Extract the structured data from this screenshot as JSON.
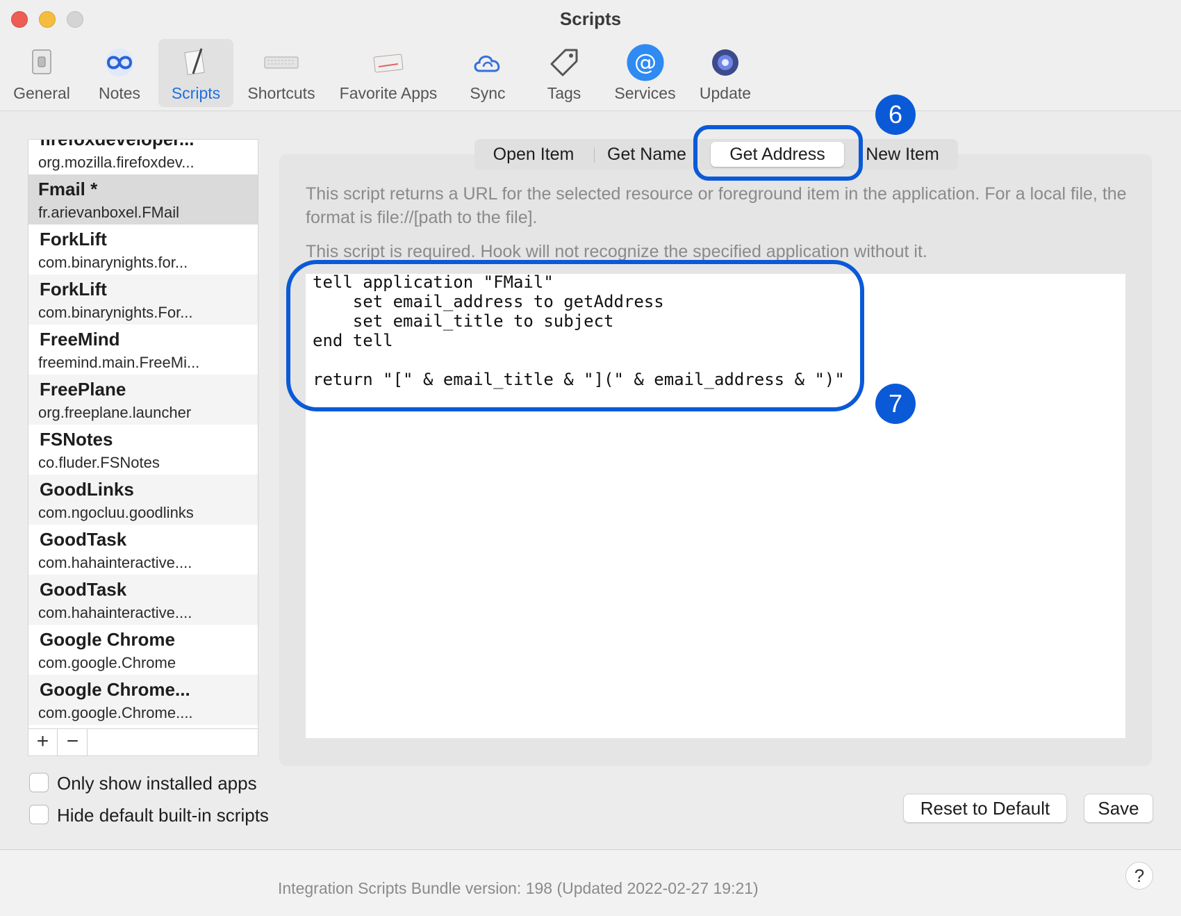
{
  "window": {
    "title": "Scripts"
  },
  "toolbar": {
    "items": [
      {
        "label": "General",
        "icon": "general-switch-icon"
      },
      {
        "label": "Notes",
        "icon": "notes-infinity-icon"
      },
      {
        "label": "Scripts",
        "icon": "scripts-paper-pen-icon",
        "active": true
      },
      {
        "label": "Shortcuts",
        "icon": "keyboard-icon"
      },
      {
        "label": "Favorite Apps",
        "icon": "favorite-apps-icon"
      },
      {
        "label": "Sync",
        "icon": "cloud-sync-icon"
      },
      {
        "label": "Tags",
        "icon": "tag-icon"
      },
      {
        "label": "Services",
        "icon": "at-sign-icon"
      },
      {
        "label": "Update",
        "icon": "update-icon"
      }
    ]
  },
  "sidebar": {
    "partial_top": {
      "name": "firefoxdeveloper...",
      "bundle": "org.mozilla.firefoxdev..."
    },
    "items": [
      {
        "name": "Fmail *",
        "bundle": "fr.arievanboxel.FMail",
        "selected": true
      },
      {
        "name": "ForkLift",
        "bundle": "com.binarynights.for..."
      },
      {
        "name": "ForkLift",
        "bundle": "com.binarynights.For..."
      },
      {
        "name": "FreeMind",
        "bundle": "freemind.main.FreeMi..."
      },
      {
        "name": "FreePlane",
        "bundle": "org.freeplane.launcher"
      },
      {
        "name": "FSNotes",
        "bundle": "co.fluder.FSNotes"
      },
      {
        "name": "GoodLinks",
        "bundle": "com.ngocluu.goodlinks"
      },
      {
        "name": "GoodTask",
        "bundle": "com.hahainteractive...."
      },
      {
        "name": "GoodTask",
        "bundle": "com.hahainteractive...."
      },
      {
        "name": "Google Chrome",
        "bundle": "com.google.Chrome"
      },
      {
        "name": "Google Chrome...",
        "bundle": "com.google.Chrome...."
      }
    ],
    "add_label": "+",
    "remove_label": "−"
  },
  "tabs": {
    "open_item": "Open Item",
    "get_name": "Get Name",
    "get_address": "Get Address",
    "new_item": "New Item",
    "selected": "Get Address"
  },
  "main": {
    "description": "This script returns a URL for the selected resource or foreground item in the application.  For a local file, the format is file://[path to the file].",
    "required": "This script is required. Hook will not recognize the specified application without it.",
    "code": "tell application \"FMail\"\n    set email_address to getAddress\n    set email_title to subject\nend tell\n\nreturn \"[\" & email_title & \"](\" & email_address & \")\""
  },
  "annotations": {
    "badge_6": "6",
    "badge_7": "7",
    "color": "#0a5ad8"
  },
  "options": {
    "only_installed": "Only show installed apps",
    "hide_default": "Hide default built-in scripts"
  },
  "buttons": {
    "reset": "Reset to Default",
    "save": "Save"
  },
  "footer": {
    "version": "Integration Scripts Bundle version: 198 (Updated 2022-02-27 19:21)",
    "help": "?"
  }
}
